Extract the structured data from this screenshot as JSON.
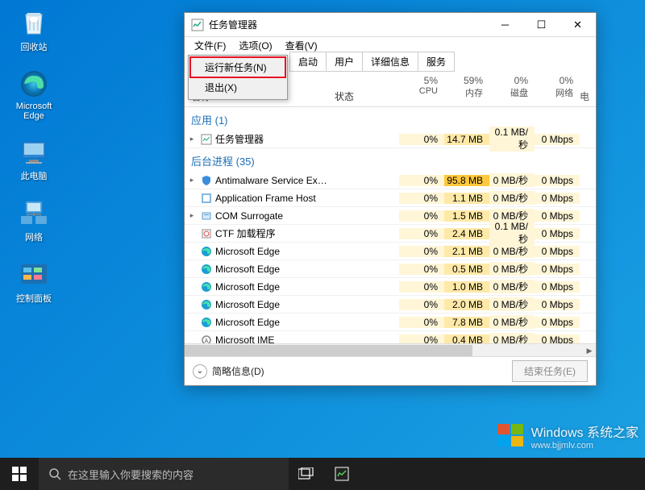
{
  "desktop": {
    "icons": [
      {
        "label": "回收站",
        "type": "recycle-bin"
      },
      {
        "label": "Microsoft Edge",
        "type": "edge"
      },
      {
        "label": "此电脑",
        "type": "this-pc"
      },
      {
        "label": "网络",
        "type": "network"
      },
      {
        "label": "控制面板",
        "type": "control-panel"
      }
    ]
  },
  "taskmgr": {
    "title": "任务管理器",
    "menu": {
      "file": "文件(F)",
      "options": "选项(O)",
      "view": "查看(V)"
    },
    "file_menu": {
      "run_new": "运行新任务(N)",
      "exit": "退出(X)"
    },
    "tabs": [
      "启动",
      "用户",
      "详细信息",
      "服务"
    ],
    "columns": {
      "name": "名称",
      "status": "状态",
      "cpu_pct": "5%",
      "cpu": "CPU",
      "mem_pct": "59%",
      "mem": "内存",
      "disk_pct": "0%",
      "disk": "磁盘",
      "net_pct": "0%",
      "net": "网络",
      "net_extra": "电"
    },
    "groups": {
      "apps": {
        "label": "应用 (1)"
      },
      "bg": {
        "label": "后台进程 (35)"
      }
    },
    "rows": [
      {
        "group": "apps",
        "name": "任务管理器",
        "icon": "tm",
        "exp": true,
        "cpu": "0%",
        "mem": "14.7 MB",
        "memhot": false,
        "disk": "0.1 MB/秒",
        "net": "0 Mbps"
      },
      {
        "group": "bg",
        "name": "Antimalware Service Executa...",
        "icon": "shield",
        "exp": true,
        "cpu": "0%",
        "mem": "95.8 MB",
        "memhot": true,
        "disk": "0 MB/秒",
        "net": "0 Mbps"
      },
      {
        "group": "bg",
        "name": "Application Frame Host",
        "icon": "frame",
        "exp": false,
        "cpu": "0%",
        "mem": "1.1 MB",
        "memhot": false,
        "disk": "0 MB/秒",
        "net": "0 Mbps"
      },
      {
        "group": "bg",
        "name": "COM Surrogate",
        "icon": "com",
        "exp": true,
        "cpu": "0%",
        "mem": "1.5 MB",
        "memhot": false,
        "disk": "0 MB/秒",
        "net": "0 Mbps"
      },
      {
        "group": "bg",
        "name": "CTF 加载程序",
        "icon": "ctf",
        "exp": false,
        "cpu": "0%",
        "mem": "2.4 MB",
        "memhot": false,
        "disk": "0.1 MB/秒",
        "net": "0 Mbps"
      },
      {
        "group": "bg",
        "name": "Microsoft Edge",
        "icon": "edge",
        "exp": false,
        "cpu": "0%",
        "mem": "2.1 MB",
        "memhot": false,
        "disk": "0 MB/秒",
        "net": "0 Mbps"
      },
      {
        "group": "bg",
        "name": "Microsoft Edge",
        "icon": "edge",
        "exp": false,
        "cpu": "0%",
        "mem": "0.5 MB",
        "memhot": false,
        "disk": "0 MB/秒",
        "net": "0 Mbps"
      },
      {
        "group": "bg",
        "name": "Microsoft Edge",
        "icon": "edge",
        "exp": false,
        "cpu": "0%",
        "mem": "1.0 MB",
        "memhot": false,
        "disk": "0 MB/秒",
        "net": "0 Mbps"
      },
      {
        "group": "bg",
        "name": "Microsoft Edge",
        "icon": "edge",
        "exp": false,
        "cpu": "0%",
        "mem": "2.0 MB",
        "memhot": false,
        "disk": "0 MB/秒",
        "net": "0 Mbps"
      },
      {
        "group": "bg",
        "name": "Microsoft Edge",
        "icon": "edge",
        "exp": false,
        "cpu": "0%",
        "mem": "7.8 MB",
        "memhot": false,
        "disk": "0 MB/秒",
        "net": "0 Mbps"
      },
      {
        "group": "bg",
        "name": "Microsoft IME",
        "icon": "ime",
        "exp": false,
        "cpu": "0%",
        "mem": "0.4 MB",
        "memhot": false,
        "disk": "0 MB/秒",
        "net": "0 Mbps"
      }
    ],
    "footer": {
      "brief": "简略信息(D)",
      "end_task": "结束任务(E)"
    }
  },
  "taskbar": {
    "search_placeholder": "在这里输入你要搜索的内容"
  },
  "watermark": {
    "main": "Windows 系统之家",
    "sub": "www.bjjmlv.com"
  }
}
